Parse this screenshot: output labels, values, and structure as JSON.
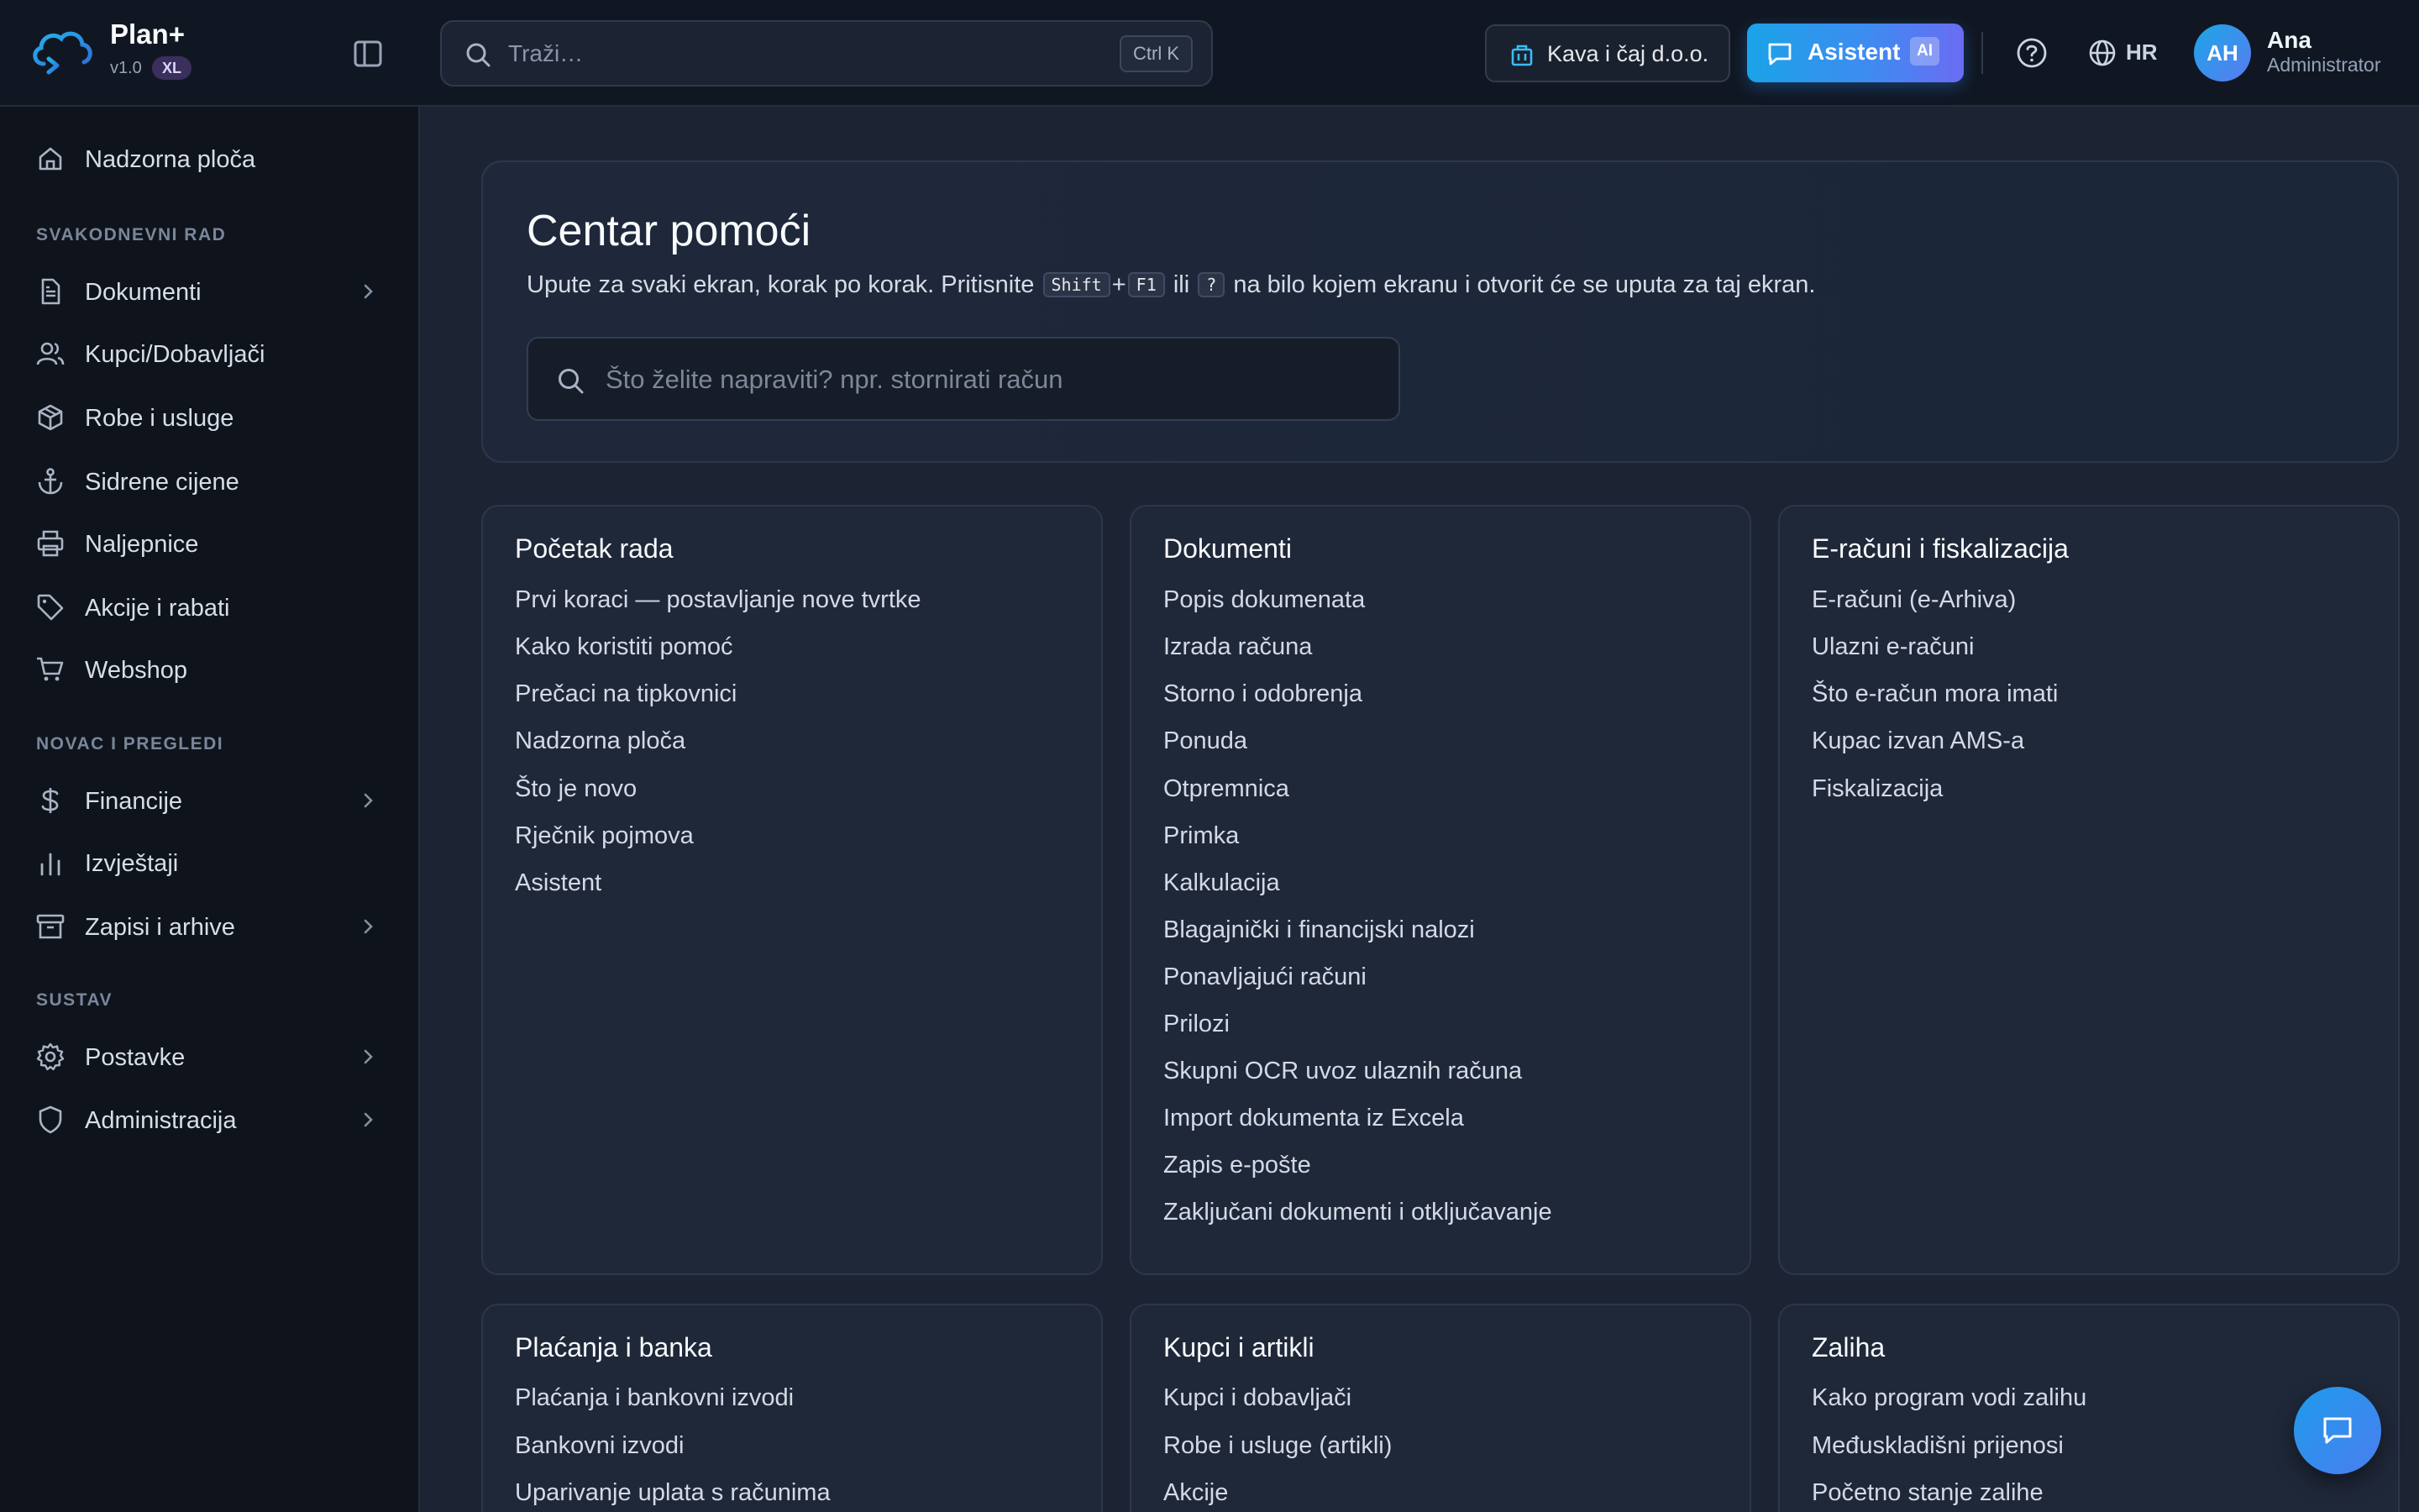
{
  "brand": {
    "name": "Plan+",
    "version": "v1.0",
    "badge": "XL"
  },
  "header": {
    "search_placeholder": "Traži…",
    "search_shortcut": "Ctrl K",
    "company": "Kava i čaj d.o.o.",
    "assistant_label": "Asistent",
    "assistant_badge": "AI",
    "language": "HR",
    "user": {
      "initials": "AH",
      "name": "Ana",
      "role": "Administrator"
    }
  },
  "sidebar": {
    "top_item": "Nadzorna ploča",
    "sections": [
      {
        "title": "SVAKODNEVNI RAD",
        "items": [
          "Dokumenti",
          "Kupci/Dobavljači",
          "Robe i usluge",
          "Sidrene cijene",
          "Naljepnice",
          "Akcije i rabati",
          "Webshop"
        ]
      },
      {
        "title": "NOVAC I PREGLEDI",
        "items": [
          "Financije",
          "Izvještaji",
          "Zapisi i arhive"
        ]
      },
      {
        "title": "SUSTAV",
        "items": [
          "Postavke",
          "Administracija"
        ]
      }
    ]
  },
  "hero": {
    "title": "Centar pomoći",
    "subtitle_before": "Upute za svaki ekran, korak po korak. Pritisnite",
    "key_shift": "Shift",
    "plus": "+",
    "key_f1": "F1",
    "or_word": "ili",
    "key_question": "?",
    "subtitle_after": "na bilo kojem ekranu i otvorit će se uputa za taj ekran.",
    "search_placeholder": "Što želite napraviti? npr. stornirati račun"
  },
  "cards": [
    {
      "title": "Početak rada",
      "links": [
        "Prvi koraci — postavljanje nove tvrtke",
        "Kako koristiti pomoć",
        "Prečaci na tipkovnici",
        "Nadzorna ploča",
        "Što je novo",
        "Rječnik pojmova",
        "Asistent"
      ]
    },
    {
      "title": "Dokumenti",
      "links": [
        "Popis dokumenata",
        "Izrada računa",
        "Storno i odobrenja",
        "Ponuda",
        "Otpremnica",
        "Primka",
        "Kalkulacija",
        "Blagajnički i financijski nalozi",
        "Ponavljajući računi",
        "Prilozi",
        "Skupni OCR uvoz ulaznih računa",
        "Import dokumenta iz Excela",
        "Zapis e-pošte",
        "Zaključani dokumenti i otključavanje"
      ]
    },
    {
      "title": "E-računi i fiskalizacija",
      "links": [
        "E-računi (e-Arhiva)",
        "Ulazni e-računi",
        "Što e-račun mora imati",
        "Kupac izvan AMS-a",
        "Fiskalizacija"
      ]
    },
    {
      "title": "Plaćanja i banka",
      "links": [
        "Plaćanja i bankovni izvodi",
        "Bankovni izvodi",
        "Uparivanje uplata s računima"
      ]
    },
    {
      "title": "Kupci i artikli",
      "links": [
        "Kupci i dobavljači",
        "Robe i usluge (artikli)",
        "Akcije"
      ]
    },
    {
      "title": "Zaliha",
      "links": [
        "Kako program vodi zalihu",
        "Međuskladišni prijenosi",
        "Početno stanje zalihe"
      ]
    }
  ],
  "colors": {
    "accent": "#1aa3e8",
    "accent_secondary": "#6a6cf3",
    "background": "#1c2434",
    "sidebar": "#0f141c"
  }
}
